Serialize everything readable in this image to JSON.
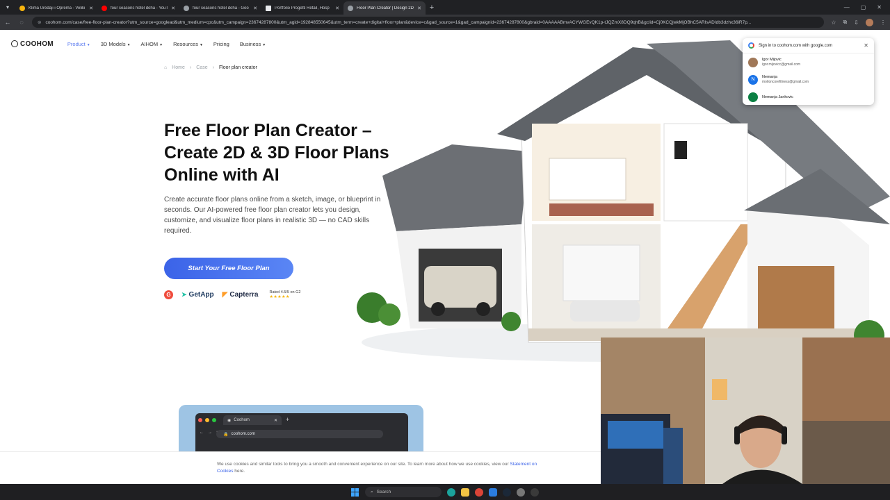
{
  "browser": {
    "tabs": [
      {
        "label": "Klima Uređaji i Oprema - Veliki",
        "color": "#f6b40e",
        "active": false
      },
      {
        "label": "four seasons hotel doha - YouT",
        "color": "#ff0000",
        "active": false
      },
      {
        "label": "four seasons hotel doha - Goo",
        "color": "#9aa0a6",
        "active": false
      },
      {
        "label": "Portfolio Progetti Retail, Hosp",
        "color": "#e8eaed",
        "active": false
      },
      {
        "label": "Floor Plan Creator | Design 2D",
        "color": "#9aa0a6",
        "active": true
      }
    ],
    "url": "coohom.com/case/free-floor-plan-creator?utm_source=googlead&utm_medium=cpc&utm_campaign=23674287800&utm_agid=192848550645&utm_term=create+digital+floor+plan&device=c&gad_source=1&gad_campaignid=23674287800&gbraid=0AAAAABmvACYWGEvQK1p-tJQZmX8DQ9qhB&gclid=Cj0KCQjwkMjOBhC5ARIsADIdb3dzhx36iR7p..."
  },
  "nav": {
    "logo": "COOHOM",
    "items": [
      {
        "label": "Product",
        "active": true,
        "dropdown": true
      },
      {
        "label": "3D Models",
        "active": false,
        "dropdown": true
      },
      {
        "label": "AIHOM",
        "active": false,
        "dropdown": true
      },
      {
        "label": "Resources",
        "active": false,
        "dropdown": true
      },
      {
        "label": "Pricing",
        "active": false,
        "dropdown": false
      },
      {
        "label": "Business",
        "active": false,
        "dropdown": true
      }
    ]
  },
  "breadcrumb": {
    "home": "Home",
    "case": "Case",
    "current": "Floor plan creator"
  },
  "hero": {
    "title": "Free Floor Plan Creator – Create 2D & 3D Floor Plans Online with AI",
    "description": "Create accurate floor plans online from a sketch, image, or blueprint in seconds. Our AI-powered free floor plan creator lets you design, customize, and visualize floor plans in realistic 3D — no CAD skills required.",
    "cta": "Start Your Free Floor Plan"
  },
  "badges": {
    "g2": "G",
    "getapp": "GetApp",
    "capterra": "Capterra",
    "rating": "Rated 4.5/5 on G2",
    "stars": "★★★★★"
  },
  "google_popup": {
    "title": "Sign in to coohom.com with google.com",
    "accounts": [
      {
        "name": "Igor Mijovic",
        "email": "igor.mijovicc@gmail.com",
        "initial": "",
        "color": "#a07858"
      },
      {
        "name": "Nemanja",
        "email": "motioncorefitness@gmail.com",
        "initial": "N",
        "color": "#1a73e8"
      },
      {
        "name": "Nemanja Jankovic",
        "email": "",
        "initial": "",
        "color": "#0b8043"
      }
    ]
  },
  "mock": {
    "tab": "Coohom",
    "url": "coohom.com"
  },
  "cookie": {
    "text_before": "We use cookies and similar tools to bring you a smooth and convenient experience on our site. To learn more about how we use cookies, view our ",
    "link": "Statement on Cookies",
    "text_after": " here."
  },
  "taskbar": {
    "search": "Search"
  },
  "colors": {
    "accent": "#3b63e8",
    "nav_active": "#5b7bf0"
  }
}
